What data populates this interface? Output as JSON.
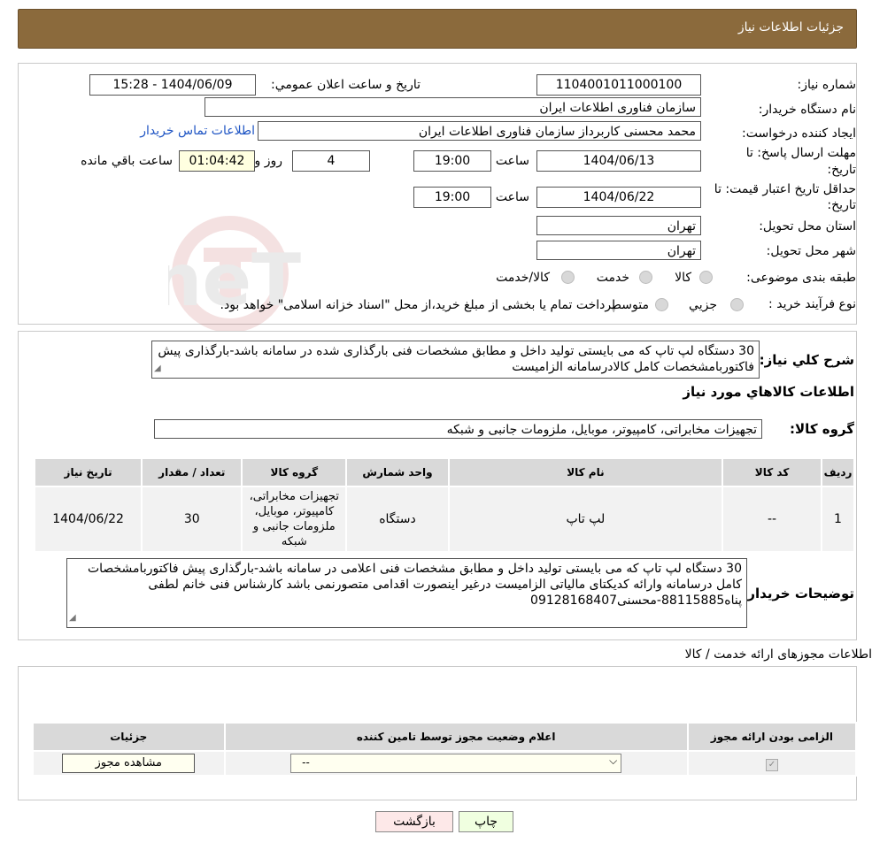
{
  "header": {
    "title": "جزئیات اطلاعات نیاز"
  },
  "form": {
    "need_number_label": "شماره نیاز:",
    "need_number": "1104001011000100",
    "announce_label": "تاریخ و ساعت اعلان عمومي:",
    "announce_value": "1404/06/09 - 15:28",
    "buyer_org_label": "نام دستگاه خريدار:",
    "buyer_org": "سازمان فناوری اطلاعات ایران",
    "creator_label": "ايجاد كننده درخواست:",
    "creator": "محمد محسنی کاربرداز سازمان فناوری اطلاعات ایران",
    "contact_link": "اطلاعات تماس خريدار",
    "deadline_label_1": "مهلت ارسال پاسخ: تا",
    "deadline_label_2": "تاريخ:",
    "deadline_date": "1404/06/13",
    "time_label": "ساعت",
    "deadline_time": "19:00",
    "deadline_days": "4",
    "days_label": "روز و",
    "remaining_time": "01:04:42",
    "remaining_label": "ساعت باقي مانده",
    "validity_label_1": "حداقل تاريخ اعتبار قيمت: تا",
    "validity_label_2": "تاريخ:",
    "validity_date": "1404/06/22",
    "validity_time": "19:00",
    "province_label": "استان محل تحويل:",
    "province": "تهران",
    "city_label": "شهر محل تحويل:",
    "city": "تهران",
    "category_label": "طبقه بندی موضوعی:",
    "category_options": [
      "كالا",
      "خدمت",
      "كالا/خدمت"
    ],
    "process_label": "نوع فرآيند خريد :",
    "process_options": [
      "جزيي",
      "متوسط"
    ],
    "process_note": "پرداخت تمام يا بخشی از مبلغ خريد،از محل \"اسناد خزانه اسلامی\" خواهد بود."
  },
  "description": {
    "label": "شرح كلي نياز:",
    "text": "30 دستگاه لپ تاپ که می بایستی تولید داخل و مطابق مشخصات فنی بارگذاری شده در سامانه باشد-بارگذاری پیش فاکتوربامشخصات کامل کالادرسامانه الزامیست"
  },
  "goods": {
    "section_title": "اطلاعات كالاهاي مورد نياز",
    "group_label": "گروه كالا:",
    "group_value": "تجهیزات مخابراتی، کامپیوتر، موبایل، ملزومات جانبی و شبکه",
    "columns": [
      "رديف",
      "كد كالا",
      "نام كالا",
      "واحد شمارش",
      "گروه كالا",
      "تعداد / مقدار",
      "تاريخ نياز"
    ],
    "rows": [
      [
        "1",
        "--",
        "لپ تاپ",
        "دستگاه",
        "تجهیزات مخابراتی، کامپیوتر، موبایل، ملزومات جانبی و شبکه",
        "30",
        "1404/06/22"
      ]
    ]
  },
  "buyer_notes": {
    "label": "توضيحات خريدار:",
    "text": "30 دستگاه لپ تاپ که می بایستی تولید داخل و مطابق مشخصات فنی اعلامی در سامانه باشد-بارگذاری پیش فاکتوربامشخصات کامل درسامانه وارائه کدیکتای مالیاتی الزامیست درغیر اینصورت اقدامی متصورنمی باشد کارشناس فنی خانم لطفی پناه88115885-محسنی09128168407"
  },
  "permits": {
    "section_title": "اطلاعات مجوزهای ارائه خدمت / کالا",
    "columns": [
      "الزامی بودن ارائه مجوز",
      "اعلام وضعیت مجوز توسط تامین کننده",
      "جزئیات"
    ],
    "select_value": "--",
    "view_button": "مشاهده مجوز"
  },
  "actions": {
    "print": "چاپ",
    "back": "بازگشت"
  },
  "watermark_text": "AriaTender.neT"
}
